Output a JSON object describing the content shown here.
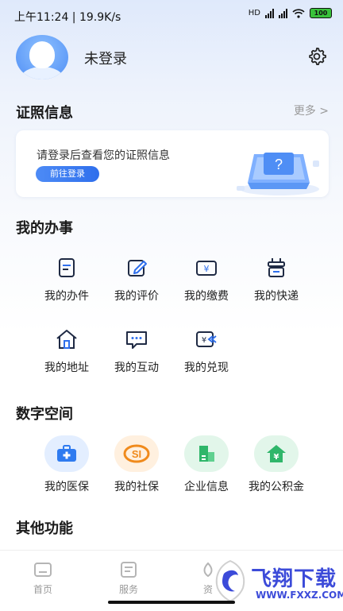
{
  "status_bar": {
    "time_speed": "上午11:24 | 19.9K/s",
    "network": "HD",
    "battery": "100"
  },
  "profile": {
    "username": "未登录"
  },
  "certificates": {
    "title": "证照信息",
    "more": "更多 >",
    "tip": "请登录后查看您的证照信息",
    "login_button": "前往登录"
  },
  "my_affairs": {
    "title": "我的办事",
    "items": [
      {
        "label": "我的办件",
        "icon": "document-icon"
      },
      {
        "label": "我的评价",
        "icon": "edit-icon"
      },
      {
        "label": "我的缴费",
        "icon": "yuan-bill-icon"
      },
      {
        "label": "我的快递",
        "icon": "express-box-icon"
      },
      {
        "label": "我的地址",
        "icon": "house-icon"
      },
      {
        "label": "我的互动",
        "icon": "chat-icon"
      },
      {
        "label": "我的兑现",
        "icon": "yuan-exchange-icon"
      }
    ]
  },
  "digital_space": {
    "title": "数字空间",
    "items": [
      {
        "label": "我的医保",
        "icon": "medical-kit-icon",
        "color": "#2f7bf0",
        "bg": "#e3eeff"
      },
      {
        "label": "我的社保",
        "icon": "social-security-icon",
        "color": "#f08a1c",
        "bg": "#fff0df"
      },
      {
        "label": "企业信息",
        "icon": "building-icon",
        "color": "#2fb66a",
        "bg": "#e2f6ea"
      },
      {
        "label": "我的公积金",
        "icon": "housing-fund-icon",
        "color": "#2fb66a",
        "bg": "#e2f6ea"
      }
    ]
  },
  "other": {
    "title": "其他功能"
  },
  "tabbar": {
    "items": [
      {
        "label": "首页",
        "icon": "home-tab-icon"
      },
      {
        "label": "服务",
        "icon": "service-tab-icon"
      },
      {
        "label": "资",
        "icon": "info-tab-icon"
      }
    ]
  },
  "watermark": {
    "text": "飞翔下载",
    "url": "WWW.FXXZ.COM"
  },
  "colors": {
    "accent": "#2f6fec",
    "text": "#222222",
    "muted": "#999999"
  }
}
